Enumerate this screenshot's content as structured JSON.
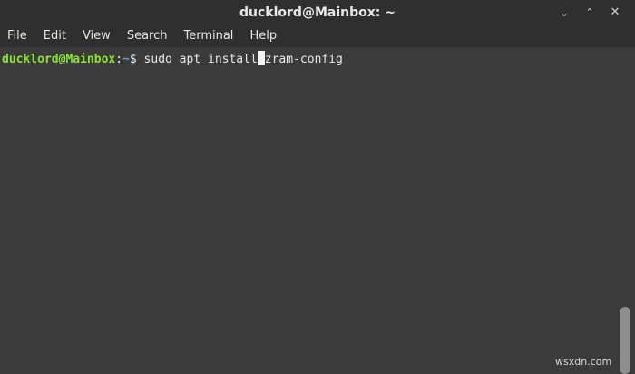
{
  "window": {
    "title": "ducklord@Mainbox: ~",
    "controls": {
      "minimize": "⌄",
      "maximize": "⌃",
      "close": "✕"
    }
  },
  "menubar": {
    "items": [
      "File",
      "Edit",
      "View",
      "Search",
      "Terminal",
      "Help"
    ]
  },
  "terminal": {
    "prompt_user": "ducklord@Mainbox",
    "prompt_sep": ":",
    "prompt_path": "~",
    "prompt_symbol": "$ ",
    "command_before_cursor": "sudo apt install",
    "command_after_cursor": "zram-config"
  },
  "watermark": "wsxdn.com",
  "colors": {
    "background": "#3b3b3b",
    "titlebar": "#2f2f2f",
    "prompt_user": "#8ae234",
    "prompt_path": "#729fcf",
    "text": "#e8e8e8"
  },
  "icons": {
    "minimize": "chevron-down-icon",
    "maximize": "chevron-up-icon",
    "close": "close-icon"
  }
}
